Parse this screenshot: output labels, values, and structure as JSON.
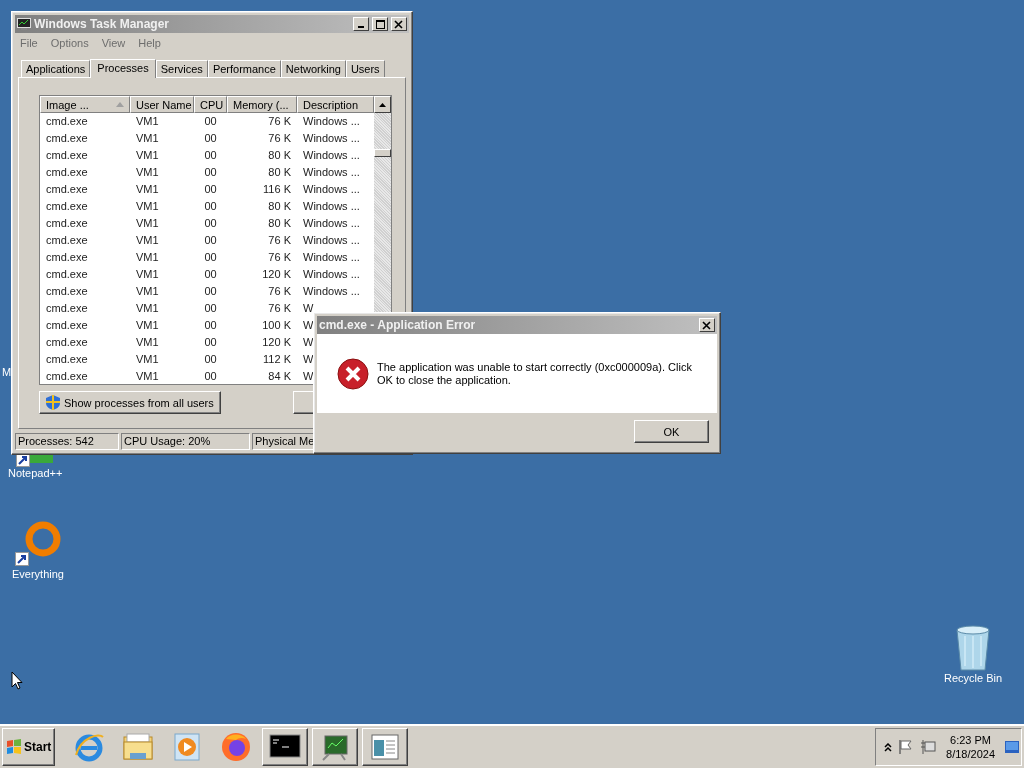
{
  "desktop": {
    "icons": [
      {
        "label": "M"
      },
      {
        "label": "Notepad++"
      },
      {
        "label": "Everything"
      },
      {
        "label": "Recycle Bin"
      }
    ]
  },
  "task_manager": {
    "title": "Windows Task Manager",
    "menu": [
      "File",
      "Options",
      "View",
      "Help"
    ],
    "tabs": [
      {
        "label": "Applications",
        "selected": false
      },
      {
        "label": "Processes",
        "selected": true
      },
      {
        "label": "Services",
        "selected": false
      },
      {
        "label": "Performance",
        "selected": false
      },
      {
        "label": "Networking",
        "selected": false
      },
      {
        "label": "Users",
        "selected": false
      }
    ],
    "table": {
      "columns": [
        "Image ...",
        "User Name",
        "CPU",
        "Memory (...",
        "Description"
      ],
      "rows": [
        [
          "cmd.exe",
          "VM1",
          "00",
          "76 K",
          "Windows ..."
        ],
        [
          "cmd.exe",
          "VM1",
          "00",
          "76 K",
          "Windows ..."
        ],
        [
          "cmd.exe",
          "VM1",
          "00",
          "80 K",
          "Windows ..."
        ],
        [
          "cmd.exe",
          "VM1",
          "00",
          "80 K",
          "Windows ..."
        ],
        [
          "cmd.exe",
          "VM1",
          "00",
          "116 K",
          "Windows ..."
        ],
        [
          "cmd.exe",
          "VM1",
          "00",
          "80 K",
          "Windows ..."
        ],
        [
          "cmd.exe",
          "VM1",
          "00",
          "80 K",
          "Windows ..."
        ],
        [
          "cmd.exe",
          "VM1",
          "00",
          "76 K",
          "Windows ..."
        ],
        [
          "cmd.exe",
          "VM1",
          "00",
          "76 K",
          "Windows ..."
        ],
        [
          "cmd.exe",
          "VM1",
          "00",
          "120 K",
          "Windows ..."
        ],
        [
          "cmd.exe",
          "VM1",
          "00",
          "76 K",
          "Windows ..."
        ],
        [
          "cmd.exe",
          "VM1",
          "00",
          "76 K",
          "W"
        ],
        [
          "cmd.exe",
          "VM1",
          "00",
          "100 K",
          "W"
        ],
        [
          "cmd.exe",
          "VM1",
          "00",
          "120 K",
          "W"
        ],
        [
          "cmd.exe",
          "VM1",
          "00",
          "112 K",
          "W"
        ],
        [
          "cmd.exe",
          "VM1",
          "00",
          "84 K",
          "W"
        ]
      ]
    },
    "button": "Show processes from all users",
    "status_bar": [
      "Processes: 542",
      "CPU Usage: 20%",
      "Physical Me"
    ]
  },
  "dialog": {
    "title": "cmd.exe - Application Error",
    "message": "The application was unable to start correctly (0xc000009a). Click OK to close the application.",
    "button": "OK"
  },
  "taskbar": {
    "start": "Start",
    "clock": {
      "time": "6:23 PM",
      "date": "8/18/2024"
    }
  }
}
